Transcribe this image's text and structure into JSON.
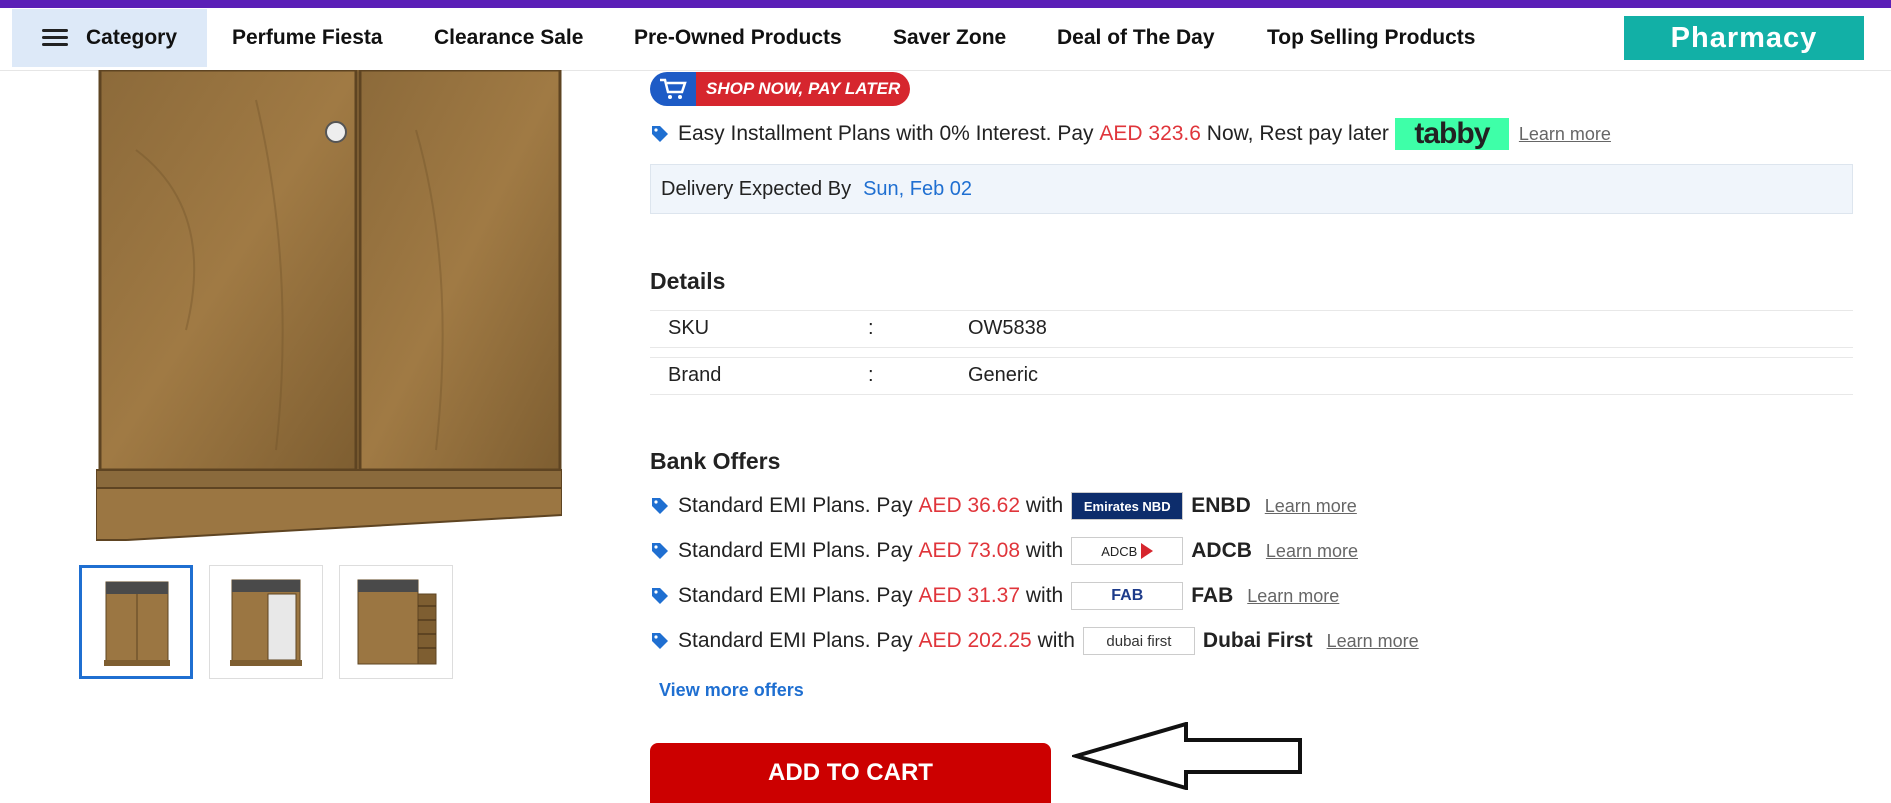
{
  "nav": {
    "category_label": "Category",
    "items": [
      "Perfume Fiesta",
      "Clearance Sale",
      "Pre-Owned Products",
      "Saver Zone",
      "Deal of The Day",
      "Top Selling Products"
    ],
    "pharmacy_label": "Pharmacy"
  },
  "promo": {
    "shop_now_label": "SHOP NOW, PAY LATER",
    "installment_prefix": "Easy Installment Plans with 0% Interest. Pay",
    "installment_amount": "AED 323.6",
    "installment_suffix": "Now, Rest pay later",
    "tabby_logo": "tabby",
    "learn_more": "Learn more"
  },
  "delivery": {
    "label": "Delivery Expected By",
    "date": "Sun, Feb 02"
  },
  "details": {
    "heading": "Details",
    "rows": [
      {
        "key": "SKU",
        "sep": ":",
        "value": "OW5838"
      },
      {
        "key": "Brand",
        "sep": ":",
        "value": "Generic"
      }
    ]
  },
  "bank_offers": {
    "heading": "Bank Offers",
    "offers": [
      {
        "prefix": "Standard EMI Plans. Pay",
        "amount": "AED 36.62",
        "with": "with",
        "logo": "Emirates NBD",
        "bank": "ENBD",
        "learn": "Learn more"
      },
      {
        "prefix": "Standard EMI Plans. Pay",
        "amount": "AED 73.08",
        "with": "with",
        "logo": "ADCB",
        "bank": "ADCB",
        "learn": "Learn more"
      },
      {
        "prefix": "Standard EMI Plans. Pay",
        "amount": "AED 31.37",
        "with": "with",
        "logo": "FAB",
        "bank": "FAB",
        "learn": "Learn more"
      },
      {
        "prefix": "Standard EMI Plans. Pay",
        "amount": "AED 202.25",
        "with": "with",
        "logo": "dubai first",
        "bank": "Dubai First",
        "learn": "Learn more"
      }
    ],
    "view_more": "View more offers"
  },
  "cart": {
    "add_to_cart": "ADD TO CART"
  },
  "colors": {
    "accent_blue": "#1f6fd1",
    "price_red": "#e0353b",
    "cart_red": "#cc0000",
    "pharmacy_teal": "#12b0a6",
    "top_bar_purple": "#5b1fb7"
  }
}
